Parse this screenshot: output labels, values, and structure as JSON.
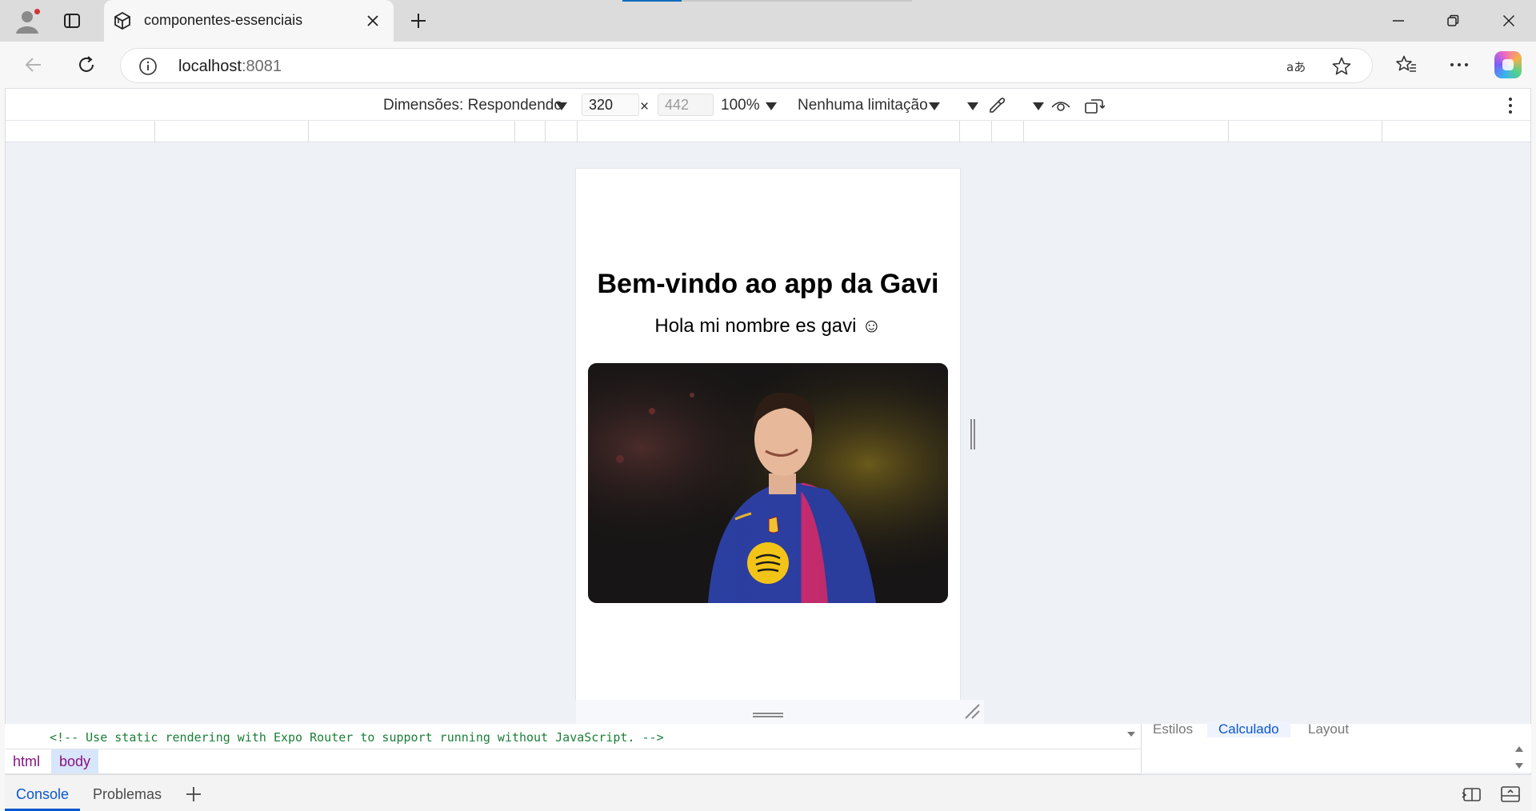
{
  "browser": {
    "tab": {
      "title": "componentes-essenciais",
      "favicon": "expo-cube-icon"
    },
    "address": {
      "host": "localhost",
      "port": ":8081"
    },
    "icons": [
      "profile-avatar-icon",
      "tab-actions-icon",
      "close-icon",
      "plus-icon",
      "minimize-icon",
      "restore-icon",
      "back-arrow-icon",
      "refresh-icon",
      "info-icon",
      "read-aloud-icon",
      "favorite-star-icon",
      "favorites-icon",
      "more-icon",
      "copilot-icon"
    ]
  },
  "device_toolbar": {
    "dimensions_label": "Dimensões: Respondendo",
    "width_value": "320",
    "times": "×",
    "height_placeholder": "442",
    "zoom": "100%",
    "throttling": "Nenhuma limitação"
  },
  "app": {
    "title": "Bem-vindo ao app da Gavi",
    "subtitle": "Hola mi nombre es gavi ☺"
  },
  "devtools": {
    "code_comment": "<!-- Use static rendering with Expo Router to support running without JavaScript. -->",
    "breadcrumbs": [
      {
        "label": "html"
      },
      {
        "label": "body"
      }
    ],
    "styles_tabs": [
      "Estilos",
      "Calculado",
      "Layout"
    ],
    "drawer_tabs": [
      "Console",
      "Problemas"
    ]
  },
  "colors": {
    "accent": "#0b57d0",
    "tag": "#881280",
    "comment": "#1a7f37"
  }
}
